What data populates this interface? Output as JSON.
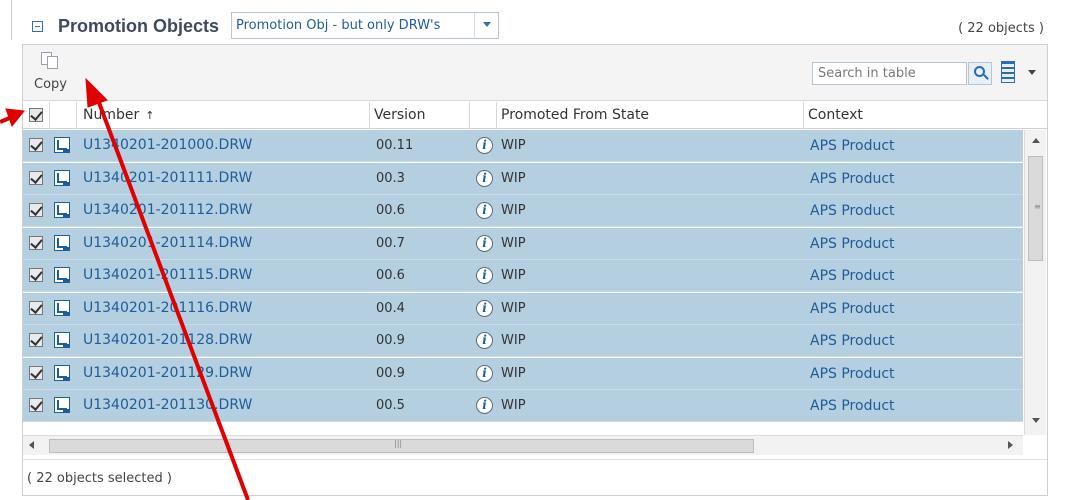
{
  "header": {
    "title": "Promotion Objects",
    "view_selected": "Promotion Obj - but only DRW's",
    "object_count": "( 22 objects )"
  },
  "toolbar": {
    "copy_label": "Copy",
    "search_placeholder": "Search in table"
  },
  "columns": {
    "number": "Number",
    "sort_indicator": "↑",
    "version": "Version",
    "promoted_from_state": "Promoted From State",
    "context": "Context"
  },
  "rows": [
    {
      "number": "U1340201-201000.DRW",
      "version": "00.11",
      "state": "WIP",
      "context": "APS Product"
    },
    {
      "number": "U1340201-201111.DRW",
      "version": "00.3",
      "state": "WIP",
      "context": "APS Product"
    },
    {
      "number": "U1340201-201112.DRW",
      "version": "00.6",
      "state": "WIP",
      "context": "APS Product"
    },
    {
      "number": "U1340201-201114.DRW",
      "version": "00.7",
      "state": "WIP",
      "context": "APS Product"
    },
    {
      "number": "U1340201-201115.DRW",
      "version": "00.6",
      "state": "WIP",
      "context": "APS Product"
    },
    {
      "number": "U1340201-201116.DRW",
      "version": "00.4",
      "state": "WIP",
      "context": "APS Product"
    },
    {
      "number": "U1340201-201128.DRW",
      "version": "00.9",
      "state": "WIP",
      "context": "APS Product"
    },
    {
      "number": "U1340201-201129.DRW",
      "version": "00.9",
      "state": "WIP",
      "context": "APS Product"
    },
    {
      "number": "U1340201-201130.DRW",
      "version": "00.5",
      "state": "WIP",
      "context": "APS Product"
    }
  ],
  "footer": {
    "selection_status": "( 22 objects selected )"
  },
  "info_glyph": "i",
  "icons": [
    "collapse-icon",
    "copy-icon",
    "search-icon",
    "column-chooser-icon",
    "drawing-icon",
    "info-icon",
    "annotation-arrow"
  ],
  "colors": {
    "selected_row": "#b4cfe0",
    "link": "#1f5c99",
    "annotation": "#e00000"
  }
}
